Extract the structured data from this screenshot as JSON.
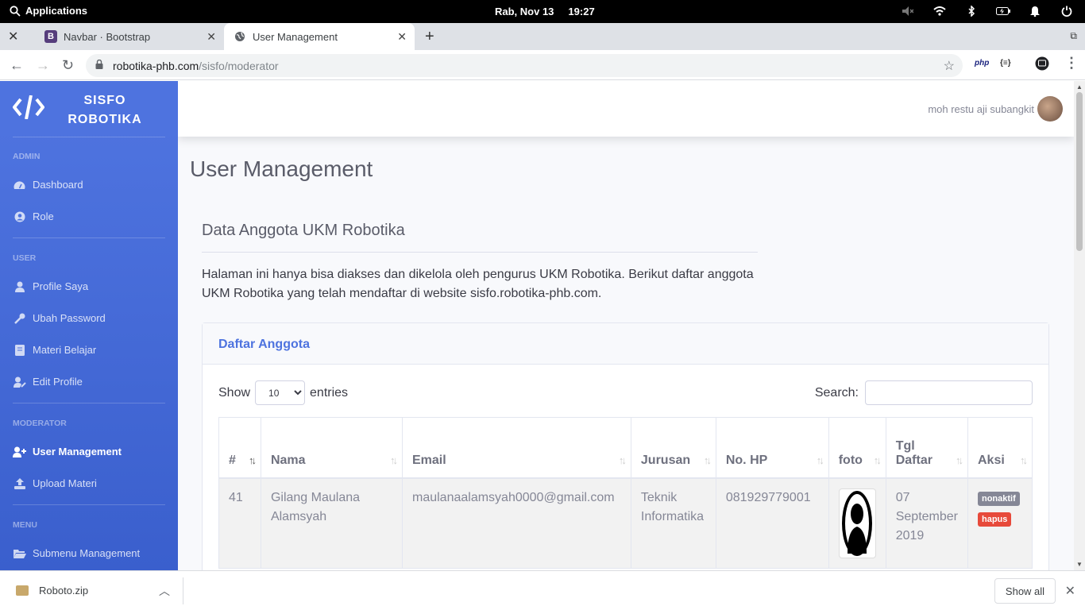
{
  "system": {
    "apps_label": "Applications",
    "day": "Rab, Nov 13",
    "time": "19:27"
  },
  "browser": {
    "tabs": [
      {
        "title": "Navbar · Bootstrap",
        "favicon": "B"
      },
      {
        "title": "User Management"
      }
    ],
    "url_host": "robotika-phb.com",
    "url_path": "/sisfo/moderator",
    "ext_php": "php",
    "ext_json": "{≡}"
  },
  "sidebar": {
    "brand_line1": "SISFO",
    "brand_line2": "ROBOTIKA",
    "sections": {
      "admin": "ADMIN",
      "user": "USER",
      "moderator": "MODERATOR",
      "menu": "MENU"
    },
    "items": {
      "dashboard": "Dashboard",
      "role": "Role",
      "profile": "Profile Saya",
      "password": "Ubah Password",
      "materi": "Materi Belajar",
      "edit_profile": "Edit Profile",
      "user_mgmt": "User Management",
      "upload": "Upload Materi",
      "submenu": "Submenu Management"
    }
  },
  "topnav": {
    "username": "moh restu aji subangkit"
  },
  "page": {
    "title": "User Management",
    "section_title": "Data Anggota UKM Robotika",
    "description": "Halaman ini hanya bisa diakses dan dikelola oleh pengurus UKM Robotika. Berikut daftar anggota UKM Robotika yang telah mendaftar di website sisfo.robotika-phb.com."
  },
  "card": {
    "header": "Daftar Anggota",
    "show_label": "Show",
    "entries_value": "10",
    "entries_label": "entries",
    "search_label": "Search:",
    "columns": [
      "#",
      "Nama",
      "Email",
      "Jurusan",
      "No. HP",
      "foto",
      "Tgl Daftar",
      "Aksi"
    ],
    "rows": [
      {
        "no": "41",
        "nama": "Gilang Maulana Alamsyah",
        "email": "maulanaalamsyah0000@gmail.com",
        "jurusan": "Teknik Informatika",
        "hp": "081929779001",
        "tgl": "07 September 2019",
        "btn_nonaktif": "nonaktif",
        "btn_hapus": "hapus"
      }
    ]
  },
  "download": {
    "filename": "Roboto.zip",
    "show_all": "Show all"
  },
  "colors": {
    "sidebar": "#4e73df",
    "badge_grey": "#858796",
    "badge_red": "#e74a3b"
  }
}
